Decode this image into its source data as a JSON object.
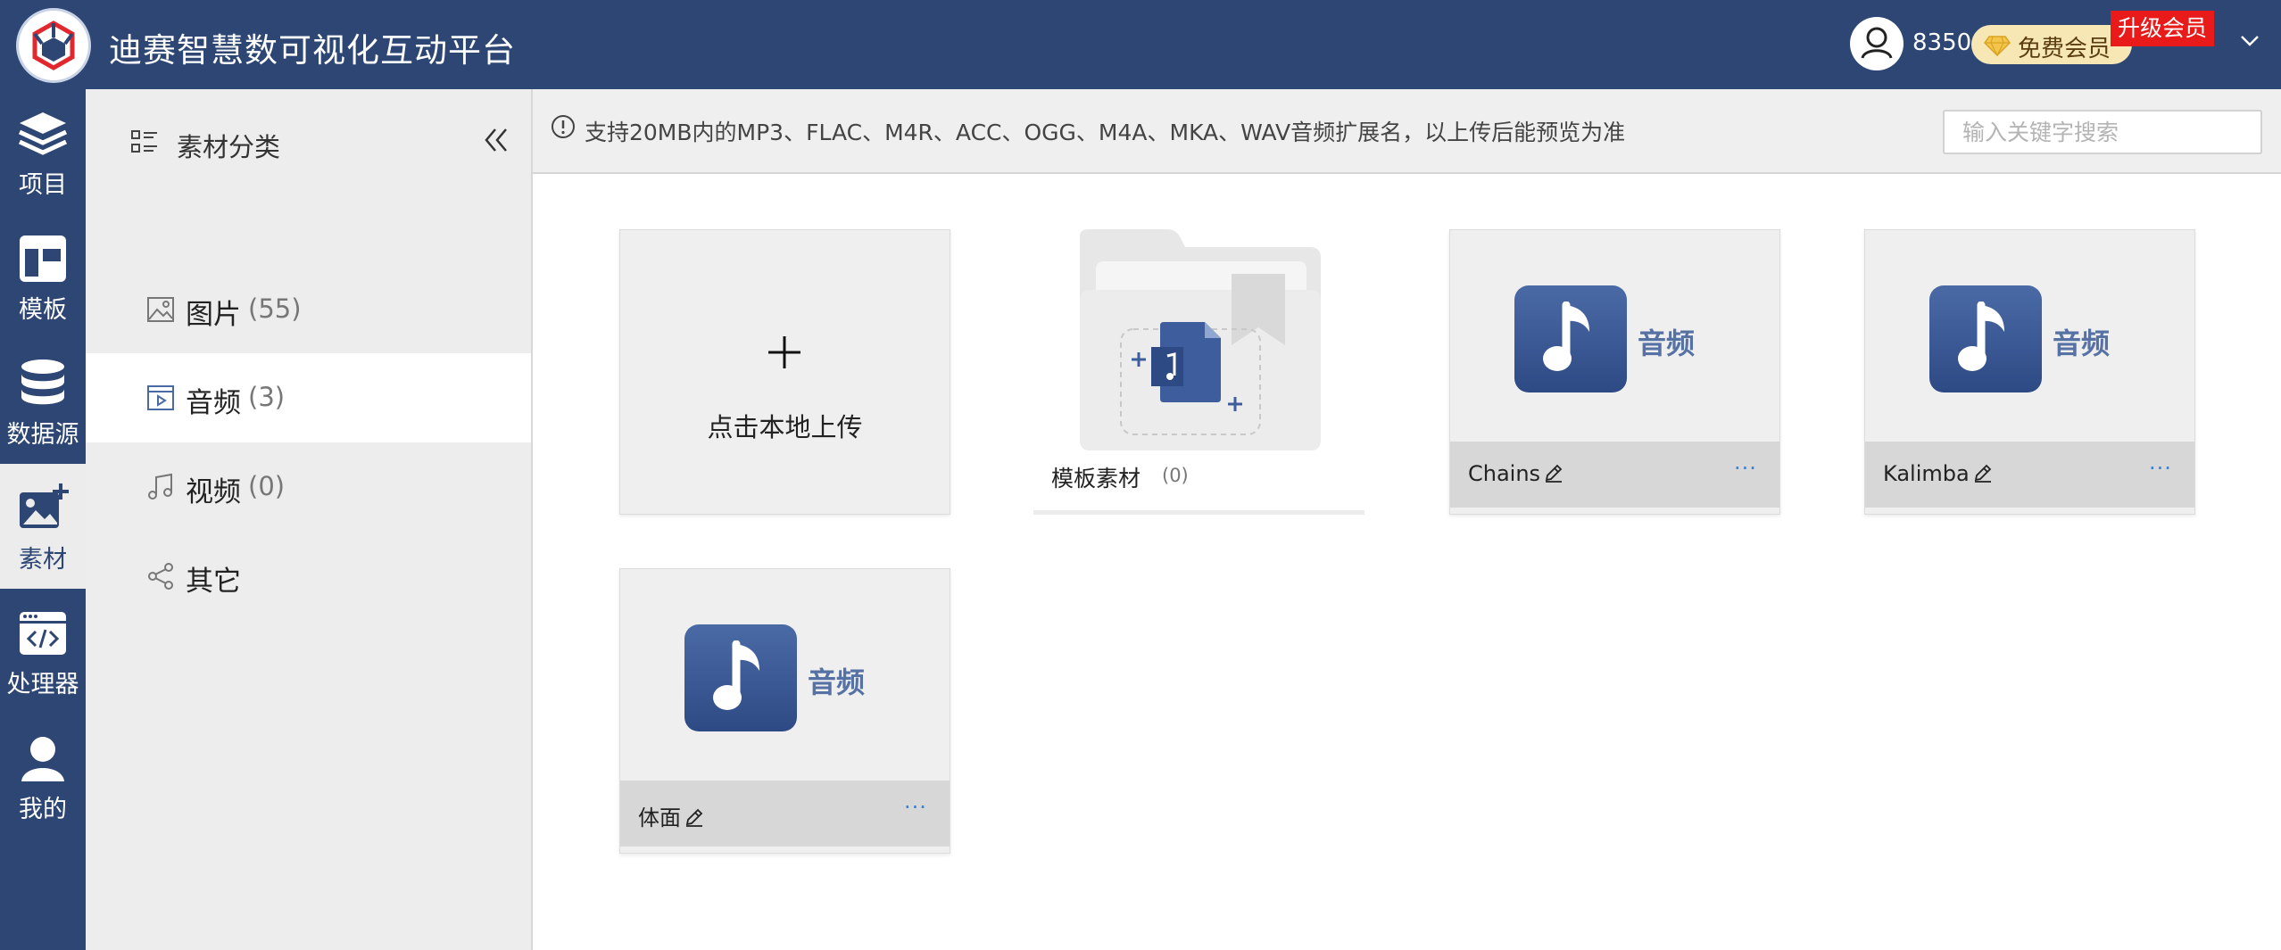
{
  "app": {
    "title": "迪赛智慧数可视化互动平台"
  },
  "user": {
    "points": "8350",
    "membership": "免费会员",
    "upgrade": "升级会员"
  },
  "rail": [
    {
      "key": "project",
      "label": "项目",
      "icon": "layers-icon"
    },
    {
      "key": "template",
      "label": "模板",
      "icon": "template-icon"
    },
    {
      "key": "datasource",
      "label": "数据源",
      "icon": "database-icon"
    },
    {
      "key": "assets",
      "label": "素材",
      "icon": "image-add-icon",
      "active": true
    },
    {
      "key": "processor",
      "label": "处理器",
      "icon": "code-window-icon"
    },
    {
      "key": "mine",
      "label": "我的",
      "icon": "user-icon"
    }
  ],
  "categories": {
    "header": "素材分类",
    "items": [
      {
        "name": "图片",
        "count": "(55)",
        "icon": "image-icon"
      },
      {
        "name": "音频",
        "count": "(3)",
        "icon": "video-play-icon",
        "selected": true
      },
      {
        "name": "视频",
        "count": "(0)",
        "icon": "music-note-icon"
      },
      {
        "name": "其它",
        "count": "",
        "icon": "share-icon"
      }
    ]
  },
  "info": {
    "text": "支持20MB内的MP3、FLAC、M4R、ACC、OGG、M4A、MKA、WAV音频扩展名，以上传后能预览为准",
    "search_placeholder": "输入关键字搜索"
  },
  "upload": {
    "label": "点击本地上传"
  },
  "folder": {
    "name": "模板素材",
    "count": "(0)"
  },
  "audio": {
    "thumb_label": "音频",
    "more": "···",
    "items": [
      {
        "title": "Chains"
      },
      {
        "title": "Kalimba"
      },
      {
        "title": "体面"
      }
    ]
  },
  "colors": {
    "primary": "#2d4674",
    "accent": "#3b82d6",
    "badge": "#e81a1a"
  }
}
